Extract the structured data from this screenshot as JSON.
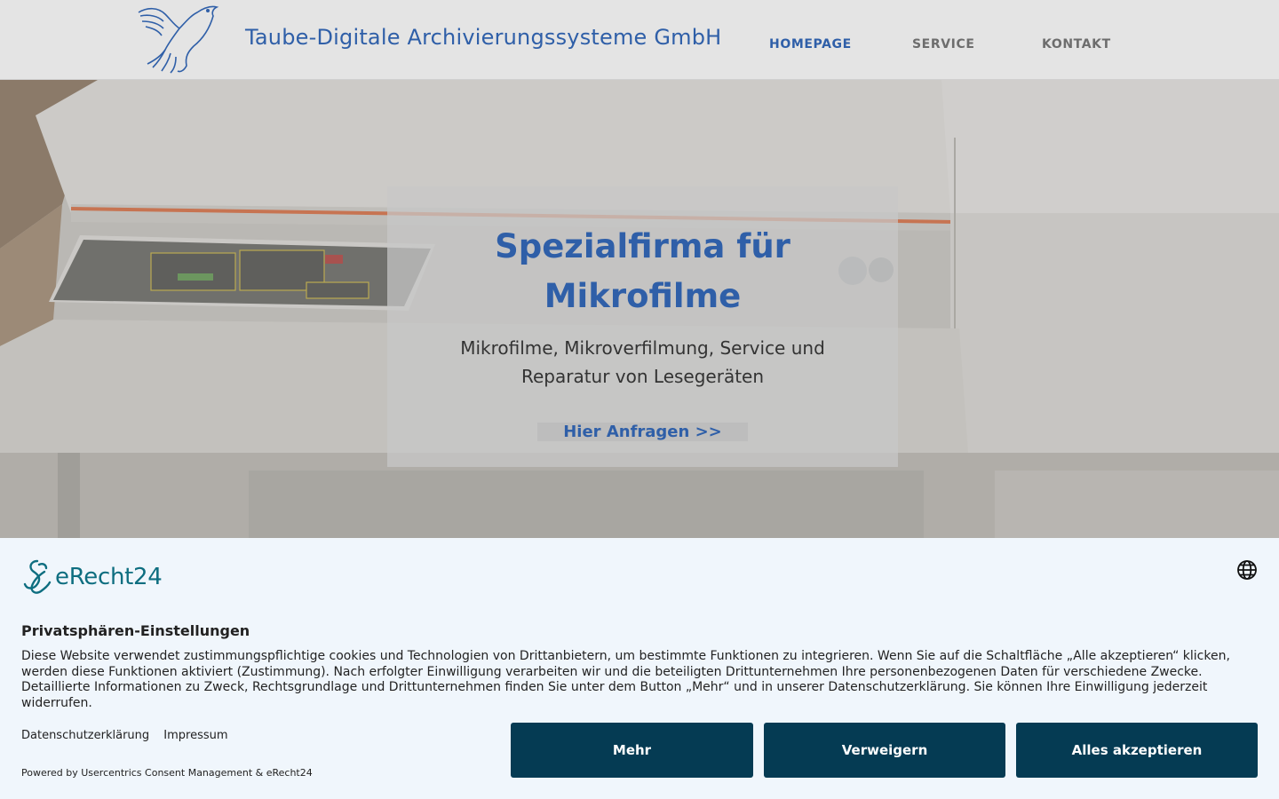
{
  "header": {
    "site_title": "Taube-Digitale Archivierungssysteme GmbH",
    "logo_icon": "dove-icon",
    "nav": [
      {
        "label": "HOMEPAGE",
        "active": true
      },
      {
        "label": "SERVICE",
        "active": false
      },
      {
        "label": "KONTAKT",
        "active": false
      }
    ]
  },
  "hero": {
    "title": "Spezialfirma für Mikrofilme",
    "subtitle": "Mikrofilme, Mikroverfilmung, Service und Reparatur von Lesegeräten",
    "button_label": "Hier Anfragen >>"
  },
  "consent": {
    "brand": "eRecht24",
    "language_icon": "globe-icon",
    "title": "Privatsphären-Einstellungen",
    "text": "Diese Website verwendet zustimmungspflichtige cookies und Technologien von Drittanbietern, um bestimmte Funktionen zu integrieren. Wenn Sie auf die Schaltfläche „Alle akzeptieren“ klicken, werden diese Funktionen aktiviert (Zustimmung). Nach erfolgter Einwilligung verarbeiten wir und die beteiligten Drittunternehmen Ihre personenbezogenen Daten für verschiedene Zwecke. Detaillierte Informationen zu Zweck, Rechtsgrundlage und Drittunternehmen finden Sie unter dem Button „Mehr“ und in unserer Datenschutzerklärung. Sie können Ihre Einwilligung jederzeit widerrufen.",
    "links": [
      "Datenschutzerklärung",
      "Impressum"
    ],
    "powered_by": "Powered by Usercentrics Consent Management & eRecht24",
    "buttons": {
      "more": "Mehr",
      "deny": "Verweigern",
      "accept": "Alles akzeptieren"
    }
  },
  "colors": {
    "accent": "#2f5fa8",
    "consent_button": "#053b53",
    "consent_background": "#f0f6fc",
    "brand_teal": "#0e6e80"
  }
}
